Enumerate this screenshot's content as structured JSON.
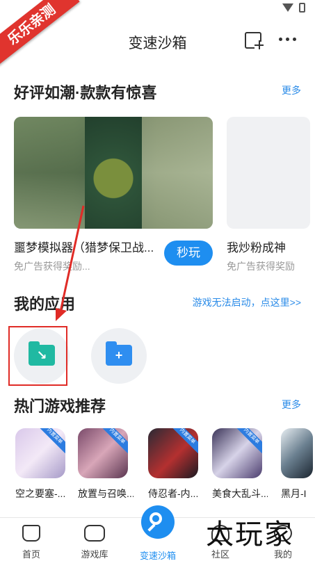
{
  "corner_badge": "乐乐亲测",
  "header": {
    "title": "变速沙箱"
  },
  "featured": {
    "title": "好评如潮·款款有惊喜",
    "more": "更多",
    "cards": [
      {
        "name": "噩梦模拟器（猎梦保卫战...",
        "sub": "免广告获得奖励...",
        "button": "秒玩"
      },
      {
        "name": "我炒粉成神",
        "sub": "免广告获得奖励"
      }
    ]
  },
  "my_apps": {
    "title": "我的应用",
    "help_link": "游戏无法启动，点这里>>"
  },
  "hot_games": {
    "title": "热门游戏推荐",
    "more": "更多",
    "ribbon": "内置菜单",
    "items": [
      {
        "name": "空之要塞-..."
      },
      {
        "name": "放置与召唤..."
      },
      {
        "name": "侍忍者-内..."
      },
      {
        "name": "美食大乱斗..."
      },
      {
        "name": "黑月-I"
      }
    ]
  },
  "bottom_nav": {
    "items": [
      {
        "label": "首页"
      },
      {
        "label": "游戏库"
      },
      {
        "label": "变速沙箱"
      },
      {
        "label": "社区"
      },
      {
        "label": "我的"
      }
    ]
  },
  "watermark": "太玩家",
  "colors": {
    "accent": "#1e8ef0",
    "highlight": "#e02b26",
    "folder_green": "#20b9a2"
  }
}
